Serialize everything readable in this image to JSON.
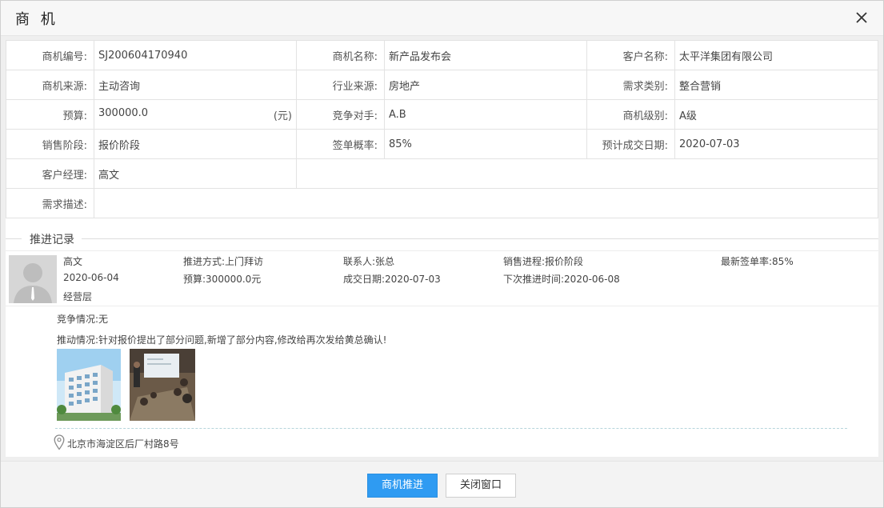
{
  "dialog": {
    "title": "商 机",
    "close_icon": "close-icon"
  },
  "info": {
    "rows": [
      [
        {
          "label": "商机编号:",
          "value": "SJ200604170940"
        },
        {
          "label": "商机名称:",
          "value": "新产品发布会"
        },
        {
          "label": "客户名称:",
          "value": "太平洋集团有限公司"
        }
      ],
      [
        {
          "label": "商机来源:",
          "value": "主动咨询"
        },
        {
          "label": "行业来源:",
          "value": "房地产"
        },
        {
          "label": "需求类别:",
          "value": "整合营销"
        }
      ],
      [
        {
          "label": "预算:",
          "value": "300000.0",
          "unit": "(元)"
        },
        {
          "label": "竞争对手:",
          "value": "A.B"
        },
        {
          "label": "商机级别:",
          "value": "A级"
        }
      ],
      [
        {
          "label": "销售阶段:",
          "value": "报价阶段"
        },
        {
          "label": "签单概率:",
          "value": "85%"
        },
        {
          "label": "预计成交日期:",
          "value": "2020-07-03"
        }
      ]
    ],
    "manager": {
      "label": "客户经理:",
      "value": "高文"
    },
    "demand": {
      "label": "需求描述:",
      "value": ""
    }
  },
  "records_title": "推进记录",
  "record": {
    "name": "高文",
    "date": "2020-06-04",
    "department": "经营层",
    "method": "推进方式:上门拜访",
    "budget": "预算:300000.0元",
    "contact": "联系人:张总",
    "deal_date": "成交日期:2020-07-03",
    "progress": "销售进程:报价阶段",
    "next_time": "下次推进时间:2020-06-08",
    "latest_rate": "最新签单率:85%",
    "competition": "竞争情况:无",
    "push_desc": "推动情况:针对报价提出了部分问题,新增了部分内容,修改给再次发给黄总确认!",
    "location": "北京市海淀区后厂村路8号"
  },
  "footer": {
    "primary_label": "商机推进",
    "close_label": "关闭窗口"
  },
  "colors": {
    "primary": "#2f9bf2",
    "header_bg": "#f7f7f7"
  }
}
